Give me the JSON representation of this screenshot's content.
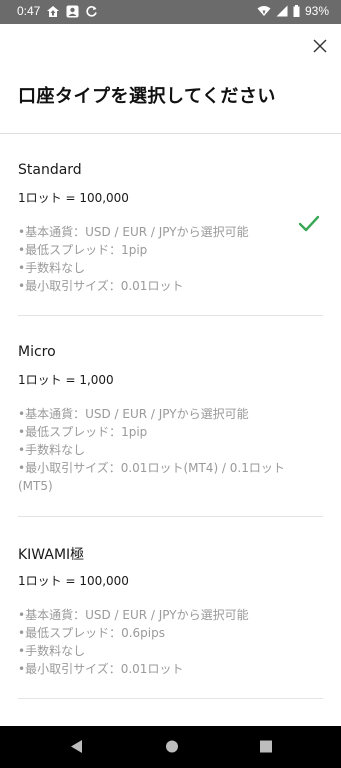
{
  "status_bar": {
    "time": "0:47",
    "battery": "93%",
    "icons": [
      "home-upload-icon",
      "account-icon",
      "sync-icon",
      "wifi-icon",
      "signal-icon",
      "battery-icon"
    ]
  },
  "header": {
    "title": "口座タイプを選択してください",
    "close_icon": "close-icon"
  },
  "options": [
    {
      "name": "Standard",
      "lot": "1ロット = 100,000",
      "selected": true,
      "features": [
        "•基本通貨：USD / EUR / JPYから選択可能",
        "•最低スプレッド：1pip",
        "•手数料なし",
        "•最小取引サイズ：0.01ロット"
      ]
    },
    {
      "name": "Micro",
      "lot": "1ロット = 1,000",
      "selected": false,
      "features": [
        "•基本通貨：USD / EUR / JPYから選択可能",
        "•最低スプレッド：1pip",
        "•手数料なし",
        "•最小取引サイズ：0.01ロット(MT4) / 0.1ロット(MT5)"
      ]
    },
    {
      "name": "KIWAMI極",
      "lot": "1ロット = 100,000",
      "selected": false,
      "features": [
        "•基本通貨：USD / EUR / JPYから選択可能",
        "•最低スプレッド：0.6pips",
        "•手数料なし",
        "•最小取引サイズ：0.01ロット"
      ]
    }
  ],
  "colors": {
    "status_bar": "#6b6b6b",
    "check": "#3aa757",
    "feature_text": "#9a9a9a",
    "nav_bar": "#000000"
  },
  "nav": {
    "icons": [
      "back-icon",
      "home-icon",
      "recents-icon"
    ]
  }
}
